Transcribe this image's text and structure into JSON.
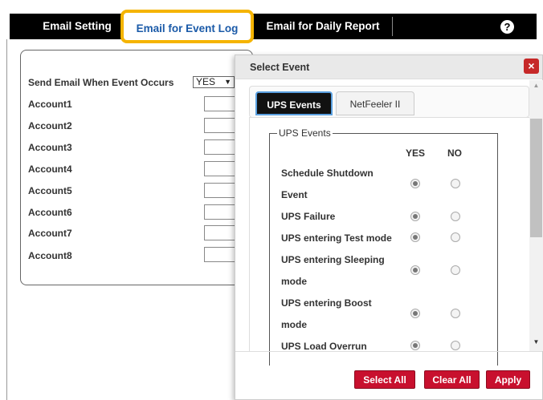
{
  "tabs": {
    "email_setting": "Email Setting",
    "email_event_log": "Email for Event Log",
    "email_daily_report": "Email for Daily Report",
    "help": "?"
  },
  "settings": {
    "send_label": "Send Email When Event Occurs",
    "send_value": "YES",
    "send_arrow": "▼",
    "accounts": [
      "Account1",
      "Account2",
      "Account3",
      "Account4",
      "Account5",
      "Account6",
      "Account7",
      "Account8"
    ]
  },
  "modal": {
    "title": "Select Event",
    "close": "×",
    "tabs": [
      "UPS Events",
      "NetFeeler II"
    ],
    "legend": "UPS Events",
    "col_yes": "YES",
    "col_no": "NO",
    "events": [
      {
        "line1": "Schedule Shutdown",
        "line2": "Event",
        "selected": "YES"
      },
      {
        "line1": "UPS Failure",
        "line2": "",
        "selected": "YES"
      },
      {
        "line1": "UPS entering Test mode",
        "line2": "",
        "selected": "YES"
      },
      {
        "line1": "UPS entering Sleeping",
        "line2": "mode",
        "selected": "YES"
      },
      {
        "line1": "UPS entering Boost",
        "line2": "mode",
        "selected": "YES"
      },
      {
        "line1": "UPS Load Overrun",
        "line2": "",
        "selected": "YES"
      }
    ],
    "buttons": {
      "select_all": "Select All",
      "clear_all": "Clear All",
      "apply": "Apply"
    },
    "scroll_up": "▲",
    "scroll_down": "▼"
  },
  "colors": {
    "accent_highlight": "#f5b400",
    "button_red": "#c8102e",
    "active_tab_text": "#1a5aa8"
  }
}
